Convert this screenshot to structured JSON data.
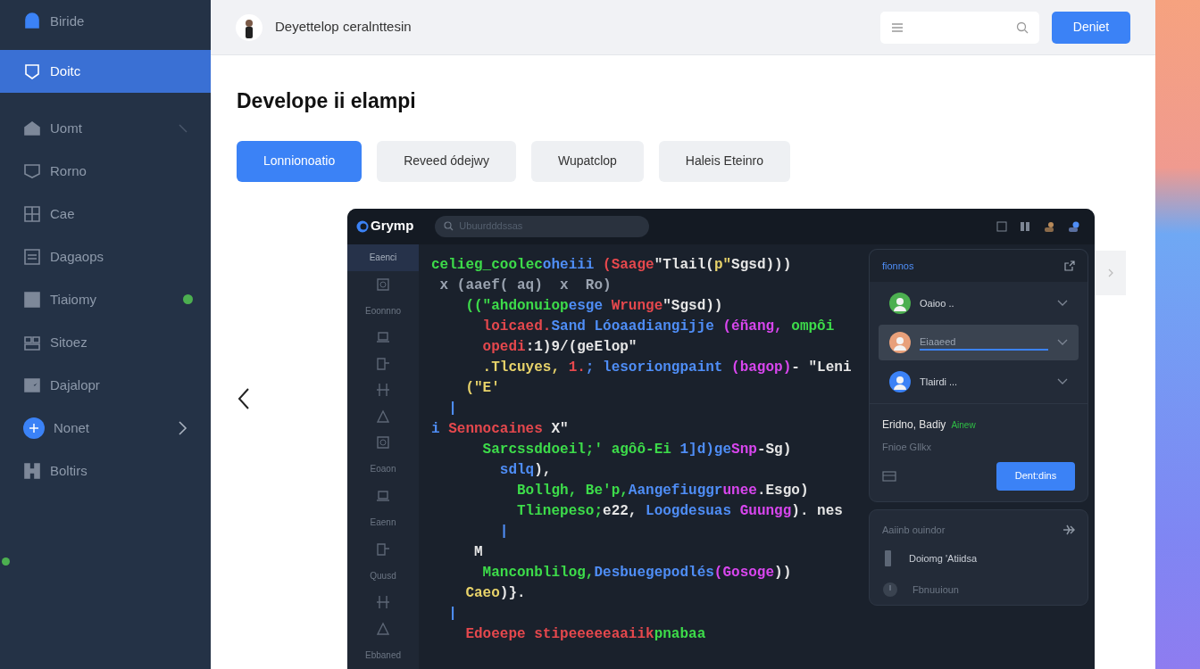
{
  "sidebar": {
    "items": [
      {
        "label": "Biride",
        "selected": false,
        "kind": "accent",
        "expandable": false
      },
      {
        "label": "Doitc",
        "selected": true,
        "kind": "plain",
        "expandable": false
      },
      {
        "label": "Uomt",
        "selected": false,
        "kind": "plain",
        "expandable": true,
        "expanded": true
      },
      {
        "label": "Rorno",
        "selected": false,
        "kind": "plain",
        "expandable": false
      },
      {
        "label": "Cae",
        "selected": false,
        "kind": "plain",
        "expandable": false
      },
      {
        "label": "Dagaops",
        "selected": false,
        "kind": "plain",
        "expandable": false
      },
      {
        "label": "Tiaiomy",
        "selected": false,
        "kind": "plain",
        "expandable": false,
        "color": "#4caf50"
      },
      {
        "label": "Sitoez",
        "selected": false,
        "kind": "plain",
        "expandable": false
      },
      {
        "label": "Dajalopr",
        "selected": false,
        "kind": "plain",
        "expandable": false
      },
      {
        "label": "Nonet",
        "selected": false,
        "kind": "circle",
        "expandable": true,
        "expanded": false
      },
      {
        "label": "Boltirs",
        "selected": false,
        "kind": "plain",
        "expandable": false
      }
    ],
    "edge_dot": {
      "color": "#4caf50"
    }
  },
  "header": {
    "title": "Deyettelop ceralnttesin",
    "button": "Deniet"
  },
  "page": {
    "heading": "Develope ii elampi",
    "tabs": [
      {
        "label": "Lonnionoatio",
        "selected": true
      },
      {
        "label": "Reveed ódejwy",
        "selected": false
      },
      {
        "label": "Wupatclop",
        "selected": false
      },
      {
        "label": "Haleis Eteinro",
        "selected": false
      }
    ]
  },
  "editor": {
    "app_name": "Grymp",
    "search_placeholder": "Ubuurdddssas",
    "rail": [
      {
        "kind": "label",
        "label": "Eaenci",
        "selected": true
      },
      {
        "kind": "icon",
        "selected": false
      },
      {
        "kind": "label",
        "label": "Eoonnno",
        "selected": false
      },
      {
        "kind": "icon",
        "selected": false
      },
      {
        "kind": "icon",
        "selected": false
      },
      {
        "kind": "icon",
        "selected": false
      },
      {
        "kind": "icon",
        "selected": false
      },
      {
        "kind": "icon",
        "selected": false
      },
      {
        "kind": "label",
        "label": "Eoaon",
        "selected": false
      },
      {
        "kind": "icon",
        "selected": false
      },
      {
        "kind": "label",
        "label": "Eaenn",
        "selected": false
      },
      {
        "kind": "icon",
        "selected": false
      },
      {
        "kind": "label",
        "label": "Quusd",
        "selected": false
      },
      {
        "kind": "icon",
        "selected": false
      },
      {
        "kind": "icon",
        "selected": false
      },
      {
        "kind": "label",
        "label": "Ebbaned",
        "selected": false
      }
    ],
    "code": [
      [
        {
          "text": "celieg_",
          "color": "#3ddc4a"
        },
        {
          "text": "coolec",
          "color": "#3ddc4a"
        },
        {
          "text": "oheiii ",
          "color": "#4f8ef7"
        },
        {
          "text": "(Saage",
          "color": "#e5484d"
        },
        {
          "text": "\"Tlail(",
          "color": "#e6e6e6"
        },
        {
          "text": "p\"",
          "color": "#e8d36a"
        },
        {
          "text": "Sgsd)))",
          "color": "#e6e6e6"
        }
      ],
      [
        {
          "text": " x (aaef( aq)  x  Ro)",
          "color": "#9aa3b0"
        }
      ],
      [
        {
          "text": "    ((\"ahdonuiop",
          "color": "#3ddc4a"
        },
        {
          "text": "esge ",
          "color": "#4f8ef7"
        },
        {
          "text": "Wrunge",
          "color": "#e5484d"
        },
        {
          "text": "\"Sgsd))",
          "color": "#e6e6e6"
        }
      ],
      [
        {
          "text": "      loicaed.",
          "color": "#e5484d"
        },
        {
          "text": "Sand ",
          "color": "#4f8ef7"
        },
        {
          "text": "Lóoaadiangijje ",
          "color": "#4f8ef7"
        },
        {
          "text": "(éñang, ",
          "color": "#d946ef"
        },
        {
          "text": "ompôi",
          "color": "#3ddc4a"
        }
      ],
      [
        {
          "text": "      opedi",
          "color": "#e5484d"
        },
        {
          "text": ":1)9/(geElop\"",
          "color": "#e6e6e6"
        }
      ],
      [
        {
          "text": "      .Tlcuyes, ",
          "color": "#e8d36a"
        },
        {
          "text": "1.",
          "color": "#e5484d"
        },
        {
          "text": "; lesoriongpaint ",
          "color": "#4f8ef7"
        },
        {
          "text": "(bagop)",
          "color": "#d946ef"
        },
        {
          "text": "- \"Leni",
          "color": "#e6e6e6"
        }
      ],
      [
        {
          "text": "    (\"E'",
          "color": "#e8d36a"
        }
      ],
      [
        {
          "text": "  |",
          "color": "#4f8ef7"
        }
      ],
      [
        {
          "text": "i ",
          "color": "#4f8ef7"
        },
        {
          "text": "Sennocaines ",
          "color": "#e5484d"
        },
        {
          "text": "X\"",
          "color": "#e6e6e6"
        }
      ],
      [
        {
          "text": "      Sarcssddoeil;' agôô-Ei ",
          "color": "#3ddc4a"
        },
        {
          "text": "1]d)ge",
          "color": "#4f8ef7"
        },
        {
          "text": "Snp",
          "color": "#d946ef"
        },
        {
          "text": "-Sg)",
          "color": "#e6e6e6"
        }
      ],
      [
        {
          "text": "        sdlq",
          "color": "#4f8ef7"
        },
        {
          "text": "),",
          "color": "#e6e6e6"
        }
      ],
      [
        {
          "text": "          Bollgh, Be'p,",
          "color": "#3ddc4a"
        },
        {
          "text": "Aangefiuggr",
          "color": "#4f8ef7"
        },
        {
          "text": "unee",
          "color": "#d946ef"
        },
        {
          "text": ".Esgo)",
          "color": "#e6e6e6"
        }
      ],
      [
        {
          "text": "          Tlinepeso;",
          "color": "#3ddc4a"
        },
        {
          "text": "e22, ",
          "color": "#e6e6e6"
        },
        {
          "text": "Loogdesuas ",
          "color": "#4f8ef7"
        },
        {
          "text": "Guungg",
          "color": "#d946ef"
        },
        {
          "text": "). nes",
          "color": "#e6e6e6"
        }
      ],
      [
        {
          "text": "        |",
          "color": "#4f8ef7"
        }
      ],
      [
        {
          "text": "     M",
          "color": "#e6e6e6"
        }
      ],
      [
        {
          "text": "      Manconblilog,",
          "color": "#3ddc4a"
        },
        {
          "text": "Desbuegepodlés",
          "color": "#4f8ef7"
        },
        {
          "text": "(Gosoge",
          "color": "#d946ef"
        },
        {
          "text": "))",
          "color": "#e6e6e6"
        }
      ],
      [
        {
          "text": "    Caeo",
          "color": "#e8d36a"
        },
        {
          "text": ")}.",
          "color": "#e6e6e6"
        }
      ],
      [
        {
          "text": "  |",
          "color": "#4f8ef7"
        }
      ],
      [
        {
          "text": "    Edoeepe stipeeeeeaaiik",
          "color": "#e5484d"
        },
        {
          "text": "pnabaa",
          "color": "#3ddc4a"
        }
      ]
    ],
    "panel": {
      "title": "fionnos",
      "rows": [
        {
          "name": "Oaioo ..",
          "selected": false,
          "color": "#4caf50"
        },
        {
          "name": "Eiaaeed",
          "selected": true,
          "color": "#e8a07a"
        },
        {
          "name": "Tlairdi ...",
          "selected": false,
          "color": "#3b82f6"
        }
      ],
      "summary_title": "Eridno, Badiy",
      "summary_badge": "Ainew",
      "summary_subtitle": "Fnioe Gllkx",
      "button": "Dent:dins"
    },
    "panel2": {
      "title": "Aaiinb ouindor",
      "items": [
        {
          "label": "Doiomg 'Atiidsa",
          "kind": "bar",
          "muted": false
        },
        {
          "label": "Fbnuuioun",
          "kind": "circle",
          "muted": true
        }
      ]
    }
  }
}
